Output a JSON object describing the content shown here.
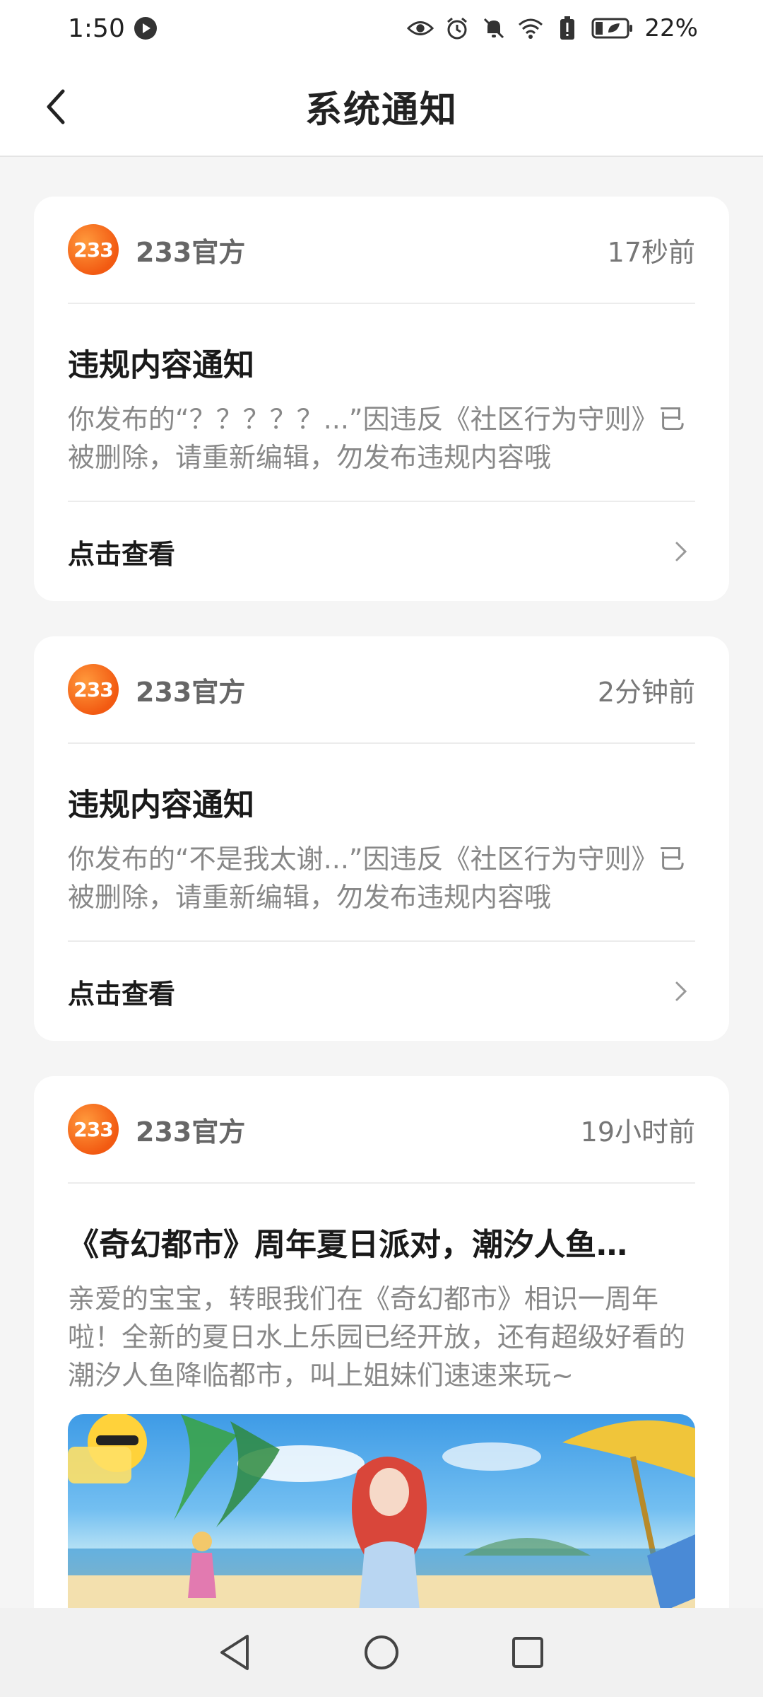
{
  "status_bar": {
    "time": "1:50",
    "battery": "22%"
  },
  "header": {
    "title": "系统通知"
  },
  "notifications": [
    {
      "logo_text": "233",
      "sender": "233官方",
      "time": "17秒前",
      "title": "违规内容通知",
      "body": "你发布的“？？？？？...”因违反《社区行为守则》已被删除，请重新编辑，勿发布违规内容哦",
      "action": "点击查看"
    },
    {
      "logo_text": "233",
      "sender": "233官方",
      "time": "2分钟前",
      "title": "违规内容通知",
      "body": "你发布的“不是我太谢...”因违反《社区行为守则》已被删除，请重新编辑，勿发布违规内容哦",
      "action": "点击查看"
    },
    {
      "logo_text": "233",
      "sender": "233官方",
      "time": "19小时前",
      "title": "《奇幻都市》周年夏日派对，潮汐人鱼…",
      "body": "亲爱的宝宝，转眼我们在《奇幻都市》相识一周年啦！全新的夏日水上乐园已经开放，还有超级好看的潮汐人鱼降临都市，叫上姐妹们速速来玩~"
    }
  ],
  "colors": {
    "accent": "#f25a12",
    "page_bg": "#f5f5f5",
    "card_bg": "#ffffff"
  }
}
